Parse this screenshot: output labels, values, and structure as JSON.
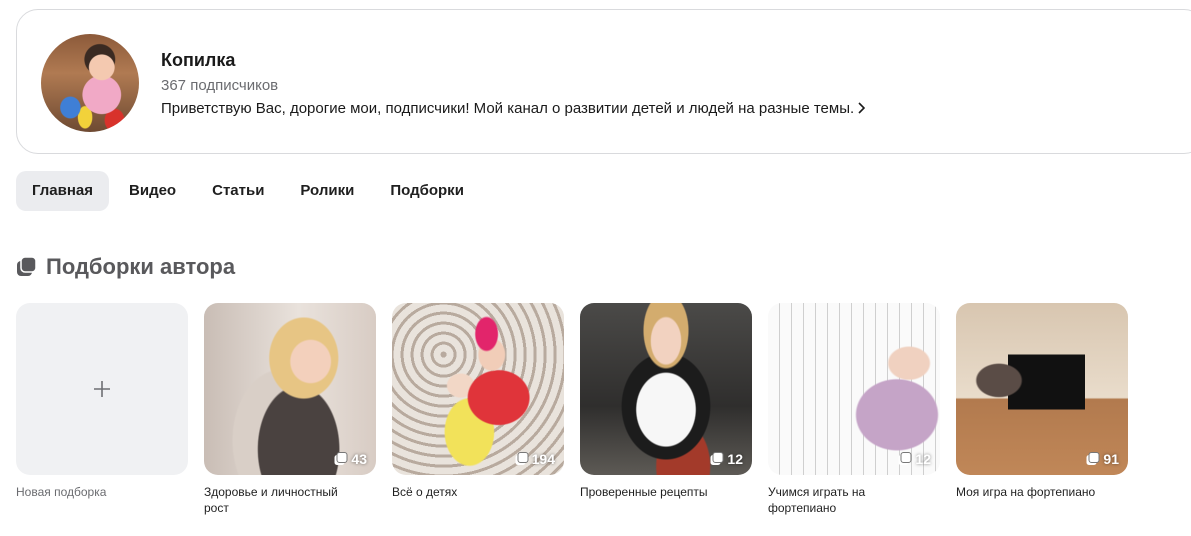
{
  "channel": {
    "name": "Копилка",
    "subscribers": "367 подписчиков",
    "description": "Приветствую Вас, дорогие мои, подписчики! Мой канал о развитии детей и людей на разные темы."
  },
  "tabs": [
    {
      "label": "Главная",
      "active": true
    },
    {
      "label": "Видео",
      "active": false
    },
    {
      "label": "Статьи",
      "active": false
    },
    {
      "label": "Ролики",
      "active": false
    },
    {
      "label": "Подборки",
      "active": false
    }
  ],
  "section": {
    "title": "Подборки автора",
    "icon": "collections-icon"
  },
  "collections": [
    {
      "title": "Новая подборка",
      "count": null,
      "icon": "plus-icon"
    },
    {
      "title": "Здоровье и личностный рост",
      "count": "43"
    },
    {
      "title": "Всё о детях",
      "count": "194"
    },
    {
      "title": "Проверенные рецепты",
      "count": "12"
    },
    {
      "title": "Учимся играть на фортепиано",
      "count": "12"
    },
    {
      "title": "Моя игра на фортепиано",
      "count": "91"
    }
  ],
  "colors": {
    "tab_active_bg": "#ebecef",
    "border": "#d9dadd",
    "muted_text": "#6b6c70"
  }
}
